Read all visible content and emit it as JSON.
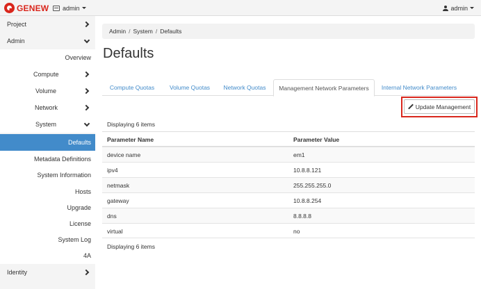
{
  "header": {
    "brand": "GENEW",
    "project_selector": "admin",
    "user_menu": "admin"
  },
  "sidebar": {
    "items": [
      {
        "label": "Project"
      },
      {
        "label": "Admin"
      },
      {
        "label": "Overview"
      },
      {
        "label": "Compute"
      },
      {
        "label": "Volume"
      },
      {
        "label": "Network"
      },
      {
        "label": "System"
      },
      {
        "label": "Defaults"
      },
      {
        "label": "Metadata Definitions"
      },
      {
        "label": "System Information"
      },
      {
        "label": "Hosts"
      },
      {
        "label": "Upgrade"
      },
      {
        "label": "License"
      },
      {
        "label": "System Log"
      },
      {
        "label": "4A"
      },
      {
        "label": "Identity"
      }
    ]
  },
  "breadcrumb": [
    "Admin",
    "System",
    "Defaults"
  ],
  "breadcrumb_separator": "/",
  "page_title": "Defaults",
  "tabs": [
    {
      "label": "Compute Quotas"
    },
    {
      "label": "Volume Quotas"
    },
    {
      "label": "Network Quotas"
    },
    {
      "label": "Management Network Parameters"
    },
    {
      "label": "Internal Network Parameters"
    }
  ],
  "update_button": "Update Management",
  "caption_top": "Displaying 6 items",
  "caption_bottom": "Displaying 6 items",
  "table": {
    "headers": [
      "Parameter Name",
      "Parameter Value"
    ],
    "rows": [
      [
        "device name",
        "em1"
      ],
      [
        "ipv4",
        "10.8.8.121"
      ],
      [
        "netmask",
        "255.255.255.0"
      ],
      [
        "gateway",
        "10.8.8.254"
      ],
      [
        "dns",
        "8.8.8.8"
      ],
      [
        "virtual",
        "no"
      ]
    ]
  },
  "colors": {
    "brand_red": "#d9261c",
    "link_blue": "#428bca",
    "active_nav": "#428bca"
  }
}
